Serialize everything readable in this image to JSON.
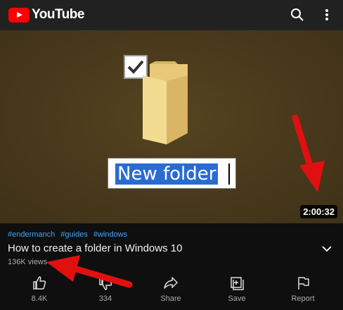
{
  "app": {
    "logo_text": "YouTube"
  },
  "video": {
    "duration": "2:00:32",
    "thumbnail_text": "New folder",
    "tags": [
      "#endermanch",
      "#guides",
      "#windows"
    ],
    "title": "How to create a folder in Windows 10",
    "views": "136K views"
  },
  "actions": [
    {
      "label": "8.4K",
      "icon": "like-icon"
    },
    {
      "label": "334",
      "icon": "dislike-icon"
    },
    {
      "label": "Share",
      "icon": "share-icon"
    },
    {
      "label": "Save",
      "icon": "save-icon"
    },
    {
      "label": "Report",
      "icon": "flag-icon"
    }
  ],
  "colors": {
    "brand_red": "#ff0000",
    "background": "#0f0f0f",
    "tag_blue": "#3ea6ff",
    "annotation_red": "#e01010"
  }
}
